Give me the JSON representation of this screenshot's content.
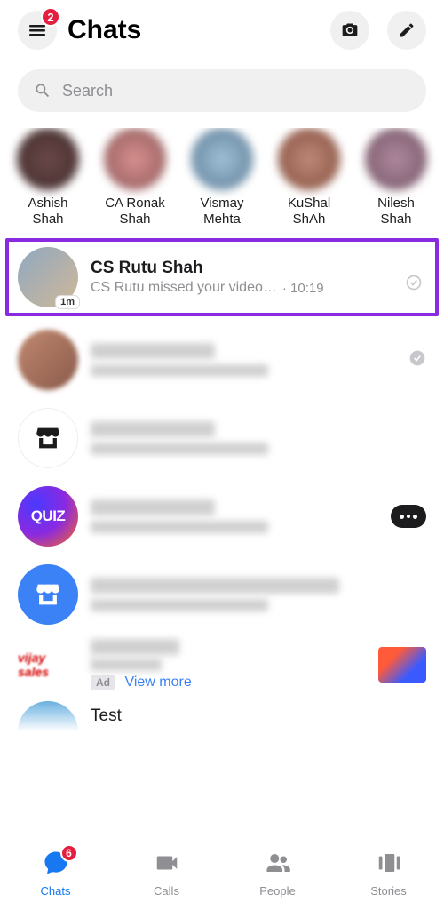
{
  "header": {
    "title": "Chats",
    "menu_badge": "2"
  },
  "search": {
    "placeholder": "Search"
  },
  "stories": [
    {
      "name": "Ashish Shah"
    },
    {
      "name": "CA Ronak Shah"
    },
    {
      "name": "Vismay Mehta"
    },
    {
      "name": "KuShal ShAh"
    },
    {
      "name": "Nilesh Shah"
    }
  ],
  "chats": {
    "highlighted": {
      "name": "CS Rutu Shah",
      "preview": "CS Rutu missed your video…",
      "time": "10:19",
      "avatar_badge": "1m"
    },
    "quiz_label": "QUIZ",
    "test_name": "Test"
  },
  "ad": {
    "logo_text": "vijay sales",
    "badge": "Ad",
    "link": "View more"
  },
  "nav": {
    "chats": {
      "label": "Chats",
      "badge": "6"
    },
    "calls": {
      "label": "Calls"
    },
    "people": {
      "label": "People"
    },
    "stories": {
      "label": "Stories"
    }
  }
}
